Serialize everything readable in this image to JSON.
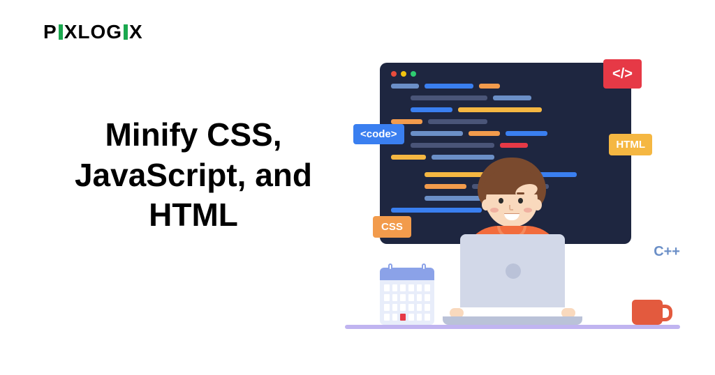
{
  "logo": {
    "part1": "P",
    "part2": "XLOG",
    "part3": "X"
  },
  "headline": "Minify CSS, JavaScript, and HTML",
  "tags": {
    "slash": "</>",
    "code": "<code>",
    "html": "HTML",
    "css": "CSS",
    "cpp": "C++"
  }
}
